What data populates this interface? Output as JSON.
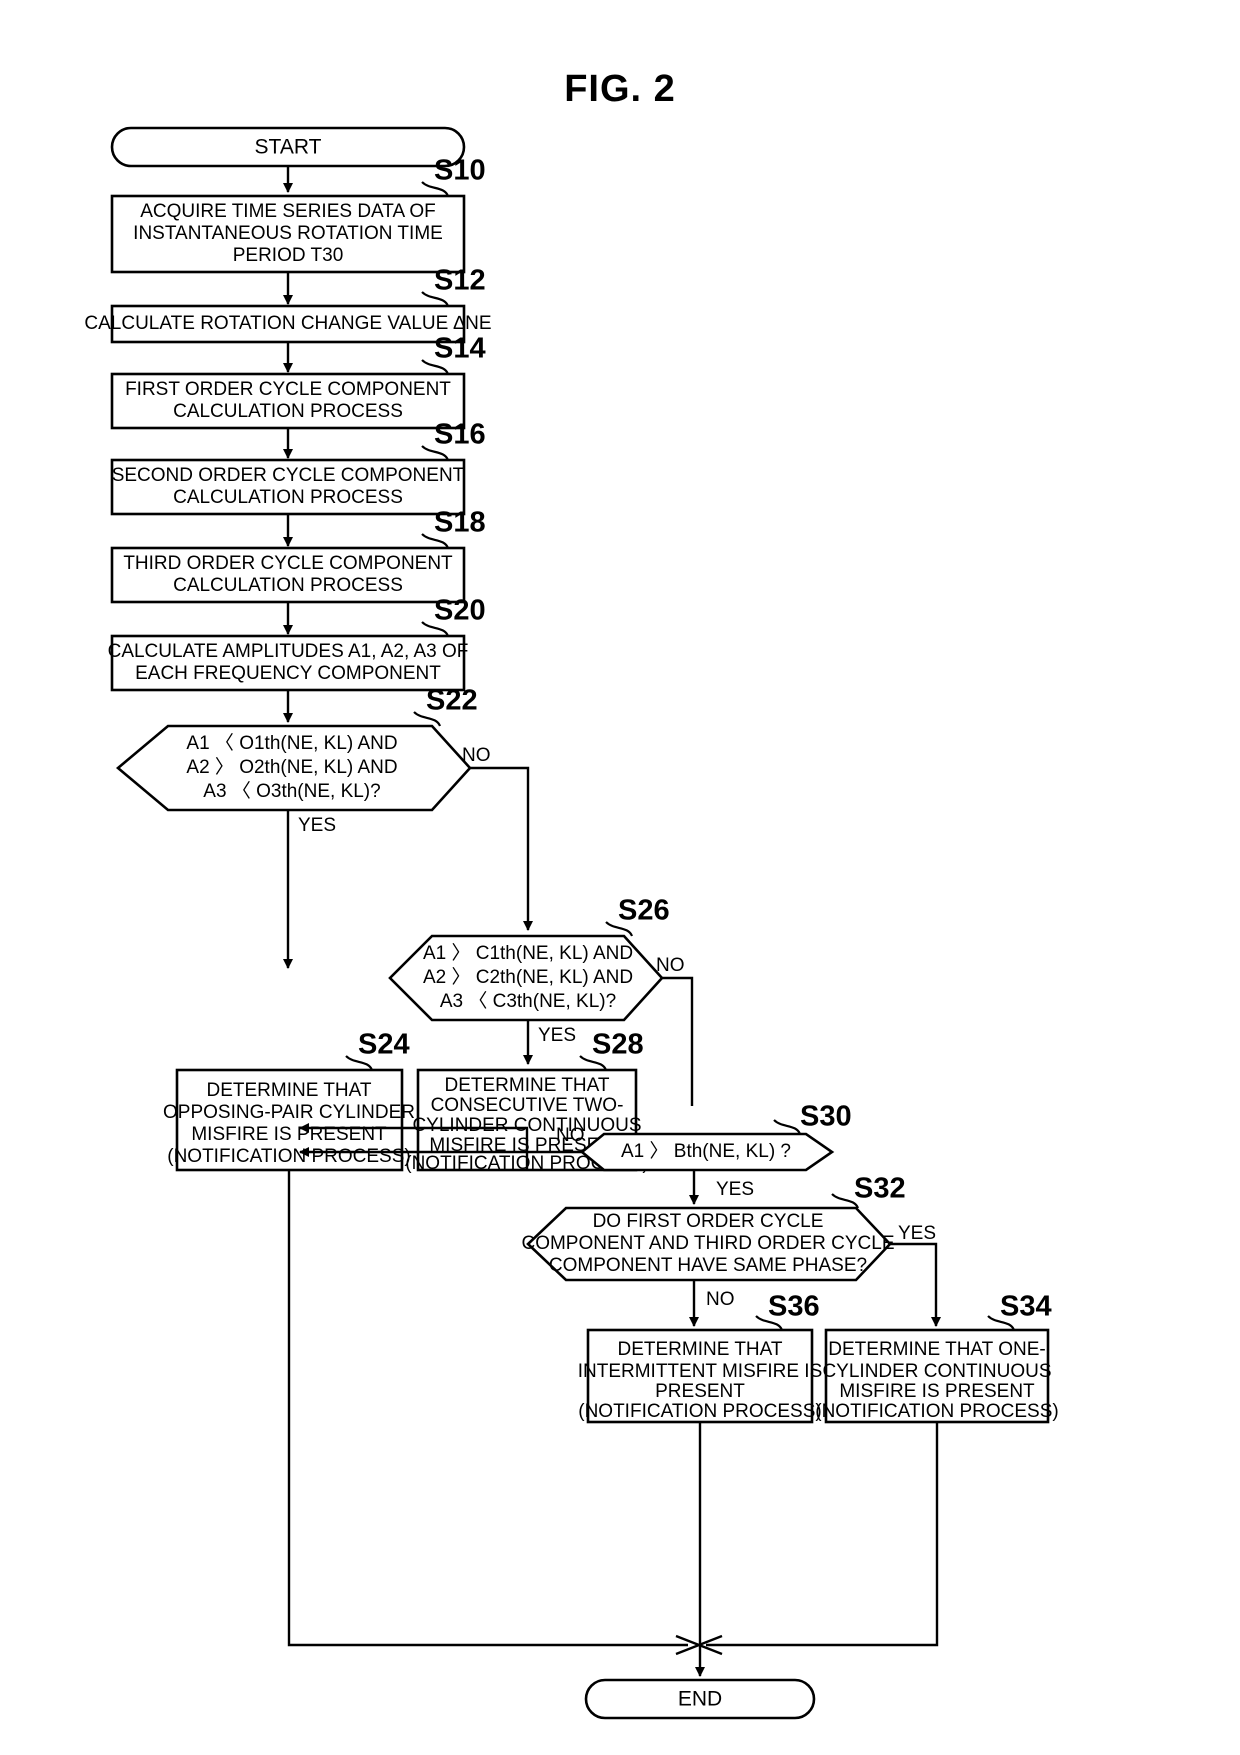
{
  "figure": {
    "title": "FIG. 2"
  },
  "terminators": {
    "start": "START",
    "end": "END"
  },
  "labels": {
    "yes": "YES",
    "no": "NO"
  },
  "steps": [
    {
      "id": "S10",
      "tag": "S10",
      "type": "process",
      "lines": [
        "ACQUIRE TIME SERIES DATA OF",
        "INSTANTANEOUS ROTATION TIME",
        "PERIOD T30"
      ]
    },
    {
      "id": "S12",
      "tag": "S12",
      "type": "process",
      "lines": [
        "CALCULATE ROTATION CHANGE VALUE ∆NE"
      ]
    },
    {
      "id": "S14",
      "tag": "S14",
      "type": "process",
      "lines": [
        "FIRST ORDER CYCLE COMPONENT",
        "CALCULATION PROCESS"
      ]
    },
    {
      "id": "S16",
      "tag": "S16",
      "type": "process",
      "lines": [
        "SECOND ORDER CYCLE COMPONENT",
        "CALCULATION PROCESS"
      ]
    },
    {
      "id": "S18",
      "tag": "S18",
      "type": "process",
      "lines": [
        "THIRD ORDER CYCLE COMPONENT",
        "CALCULATION PROCESS"
      ]
    },
    {
      "id": "S20",
      "tag": "S20",
      "type": "process",
      "lines": [
        "CALCULATE AMPLITUDES A1, A2, A3 OF",
        "EACH FREQUENCY COMPONENT"
      ]
    },
    {
      "id": "S22",
      "tag": "S22",
      "type": "decision",
      "lines": [
        "A1 〈 O1th(NE, KL) AND",
        "A2 〉 O2th(NE, KL) AND",
        "A3 〈 O3th(NE, KL)?"
      ],
      "yes_branch": "YES",
      "no_branch": "NO"
    },
    {
      "id": "S24",
      "tag": "S24",
      "type": "process",
      "lines": [
        "DETERMINE THAT",
        "OPPOSING-PAIR CYLINDER",
        "MISFIRE IS PRESENT",
        "(NOTIFICATION PROCESS)"
      ]
    },
    {
      "id": "S26",
      "tag": "S26",
      "type": "decision",
      "lines": [
        "A1 〉 C1th(NE, KL) AND",
        "A2 〉 C2th(NE, KL) AND",
        "A3 〈 C3th(NE, KL)?"
      ],
      "yes_branch": "YES",
      "no_branch": "NO"
    },
    {
      "id": "S28",
      "tag": "S28",
      "type": "process",
      "lines": [
        "DETERMINE THAT",
        "CONSECUTIVE TWO-",
        "CYLINDER CONTINUOUS",
        "MISFIRE IS PRESENT",
        "(NOTIFICATION PROCESS)"
      ]
    },
    {
      "id": "S30",
      "tag": "S30",
      "type": "decision",
      "lines": [
        "A1 〉 Bth(NE, KL) ?"
      ],
      "yes_branch": "YES",
      "no_branch": "NO"
    },
    {
      "id": "S32",
      "tag": "S32",
      "type": "decision",
      "lines": [
        "DO FIRST ORDER CYCLE",
        "COMPONENT AND THIRD ORDER CYCLE",
        "COMPONENT HAVE SAME PHASE?"
      ],
      "yes_branch": "YES",
      "no_branch": "NO"
    },
    {
      "id": "S34",
      "tag": "S34",
      "type": "process",
      "lines": [
        "DETERMINE THAT ONE-",
        "CYLINDER CONTINUOUS",
        "MISFIRE IS PRESENT",
        "(NOTIFICATION PROCESS)"
      ]
    },
    {
      "id": "S36",
      "tag": "S36",
      "type": "process",
      "lines": [
        "DETERMINE THAT",
        "INTERMITTENT MISFIRE IS",
        "PRESENT",
        "(NOTIFICATION PROCESS)"
      ]
    }
  ],
  "colors": {
    "stroke": "#000000",
    "fill": "#ffffff",
    "text": "#000000"
  }
}
